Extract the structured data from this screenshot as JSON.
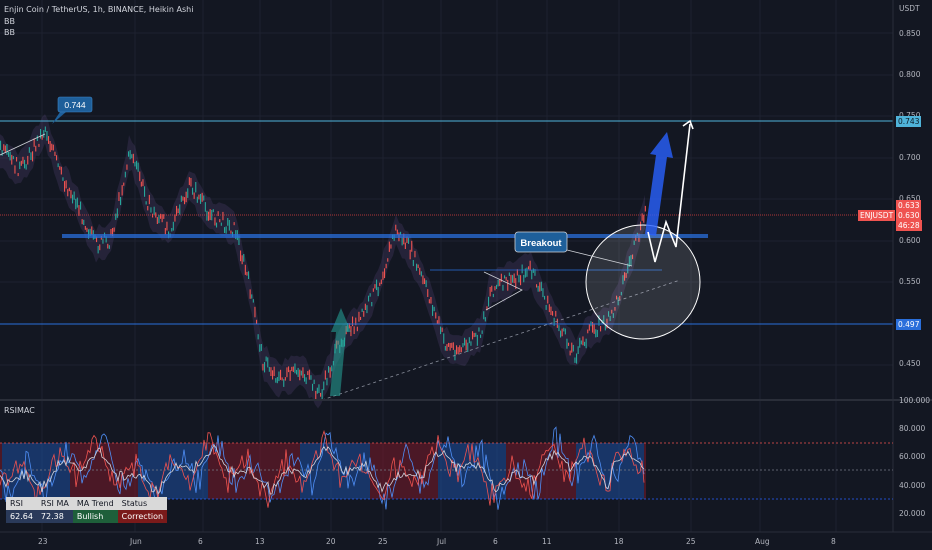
{
  "header": {
    "title": "Enjin Coin / TetherUS, 1h, BINANCE, Heikin Ashi",
    "ind1": "BB",
    "ind2": "BB",
    "currency": "USDT"
  },
  "price_axis": {
    "ticks": [
      "0.850",
      "0.800",
      "0.750",
      "0.700",
      "0.650",
      "0.600",
      "0.550",
      "0.450"
    ],
    "tags": {
      "top_level": "0.743",
      "close_a": "0.633",
      "close_b": "0.630",
      "countdown": "46:28",
      "symbol": "ENJUSDT",
      "low_level": "0.497"
    }
  },
  "rsi_axis": {
    "ticks": [
      "100.000",
      "80.000",
      "60.000",
      "40.000",
      "20.000"
    ],
    "pane_label": "RSIMAC"
  },
  "time_axis": {
    "ticks": [
      "23",
      "Jun",
      "6",
      "13",
      "20",
      "25",
      "Jul",
      "6",
      "11",
      "18",
      "25",
      "Aug",
      "8"
    ]
  },
  "annotations": {
    "high_label": "0.744",
    "breakout_label": "Breakout"
  },
  "rsi_table": {
    "headers": [
      "RSI",
      "RSI MA",
      "MA Trend",
      "Status"
    ],
    "values": [
      "62.64",
      "72.38",
      "Bullish",
      "Correction"
    ]
  },
  "colors": {
    "background": "#131722",
    "bull": "#26a69a",
    "bear": "#ef5350",
    "accent_blue": "#2962ff",
    "level_blue": "#2a6fdb"
  }
}
